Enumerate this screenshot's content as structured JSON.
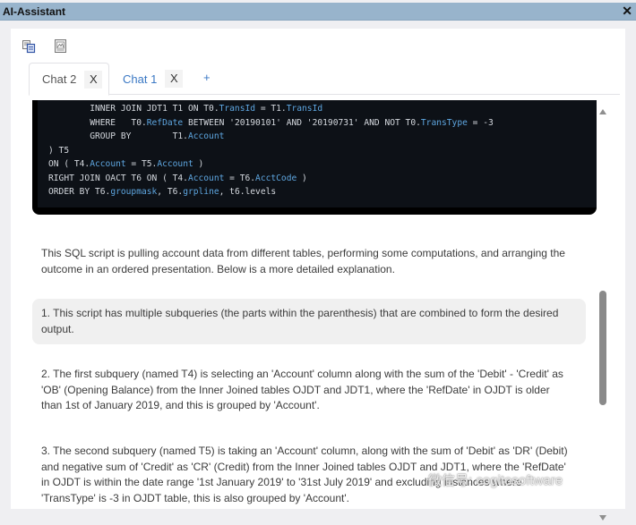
{
  "window": {
    "title": "AI-Assistant",
    "close_label": "✕"
  },
  "toolbar": {
    "icons": [
      "copy-icon",
      "export-document-icon"
    ]
  },
  "tabs": [
    {
      "label": "Chat 2",
      "close_label": "X",
      "active": true
    },
    {
      "label": "Chat 1",
      "close_label": "X",
      "active": false
    }
  ],
  "add_tab_label": "+",
  "code": {
    "lines": [
      [
        "        INNER JOIN JDT1 T1 ON T0.",
        "TransId",
        " = T1.",
        "TransId",
        ""
      ],
      [
        "        WHERE   T0.",
        "RefDate",
        " BETWEEN '20190101' AND '20190731' AND NOT T0.",
        "TransType",
        " = -3"
      ],
      [
        "        GROUP BY        T1.",
        "Account",
        "",
        "",
        ""
      ],
      [
        ") T5",
        "",
        "",
        "",
        ""
      ],
      [
        "ON ( T4.",
        "Account",
        " = T5.",
        "Account",
        " )"
      ],
      [
        "RIGHT JOIN OACT T6 ON ( T4.",
        "Account",
        " = T6.",
        "AcctCode",
        " )"
      ],
      [
        "ORDER BY T6.",
        "groupmask",
        ", T6.",
        "grpline",
        ", t6.levels"
      ]
    ]
  },
  "messages": {
    "intro": "This SQL script is pulling account data from different tables, performing some computations, and arranging the outcome in an ordered presentation. Below is a more detailed explanation.",
    "point1": "1. This script has multiple subqueries (the parts within the parenthesis) that are combined to form the desired output.",
    "point2": "2. The first subquery (named T4) is selecting an 'Account' column along with the sum of the 'Debit' - 'Credit' as 'OB' (Opening Balance) from the Inner Joined tables OJDT and JDT1, where the 'RefDate' in OJDT is older than 1st of January 2019, and this is grouped by 'Account'.",
    "point3": "3. The second subquery (named T5) is taking an 'Account' column, along with the sum of 'Debit' as 'DR' (Debit) and negative sum of 'Credit' as 'CR' (Credit) from the Inner Joined tables OJDT and JDT1, where the 'RefDate' in OJDT is within the date range '1st January 2019' to '31st July 2019' and excluding instances where 'TransType' is -3 in OJDT table, this is also grouped by 'Account'."
  },
  "watermark": "微信号: cogitosoftware"
}
